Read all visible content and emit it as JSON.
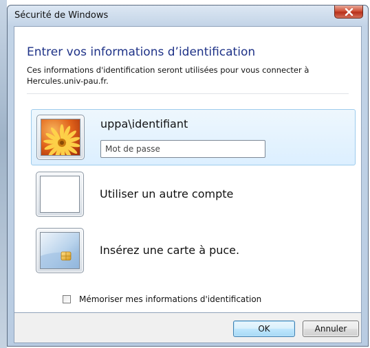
{
  "window": {
    "title": "Sécurité de Windows"
  },
  "header": {
    "heading": "Entrer vos informations d’identification",
    "description": "Ces informations d'identification seront utilisées pour vous connecter à Hercules.univ-pau.fr."
  },
  "credentials": [
    {
      "label": "uppa\\identifiant",
      "icon": "flower-user-icon",
      "password_placeholder": "Mot de passe",
      "password_value": "",
      "selected": true
    },
    {
      "label": "Utiliser un autre compte",
      "icon": "blank-account-icon",
      "selected": false
    },
    {
      "label": "Insérez une carte à puce.",
      "icon": "smart-card-icon",
      "selected": false
    }
  ],
  "remember": {
    "label": "Mémoriser mes informations d'identification",
    "checked": false
  },
  "buttons": {
    "ok": "OK",
    "cancel": "Annuler"
  },
  "colors": {
    "heading": "#1e3287",
    "selected_tile": "#dcefff",
    "close_button": "#c8452c"
  }
}
